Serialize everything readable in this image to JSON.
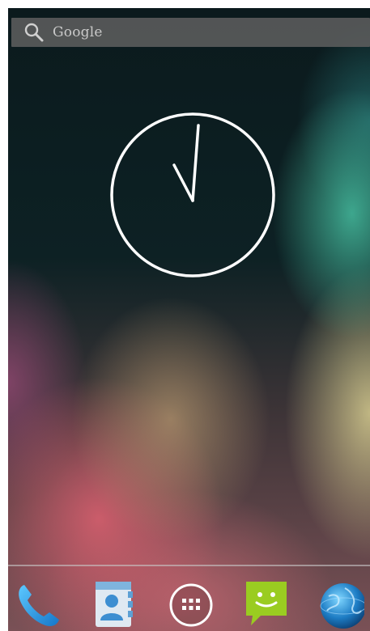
{
  "search": {
    "label": "Google",
    "icon": "search-icon"
  },
  "clock": {
    "type": "analog-clock-widget",
    "hour_hand": "hour-hand",
    "minute_hand": "minute-hand"
  },
  "dock": {
    "items": [
      {
        "name": "phone-app-icon"
      },
      {
        "name": "contacts-app-icon"
      },
      {
        "name": "app-drawer-icon"
      },
      {
        "name": "messaging-app-icon"
      },
      {
        "name": "browser-app-icon"
      }
    ]
  },
  "colors": {
    "search_bar": "#5f5f5f",
    "search_text": "#c9c9c9",
    "clock": "#ffffff",
    "phone": "#2a9fe0",
    "messaging": "#9acc21"
  }
}
